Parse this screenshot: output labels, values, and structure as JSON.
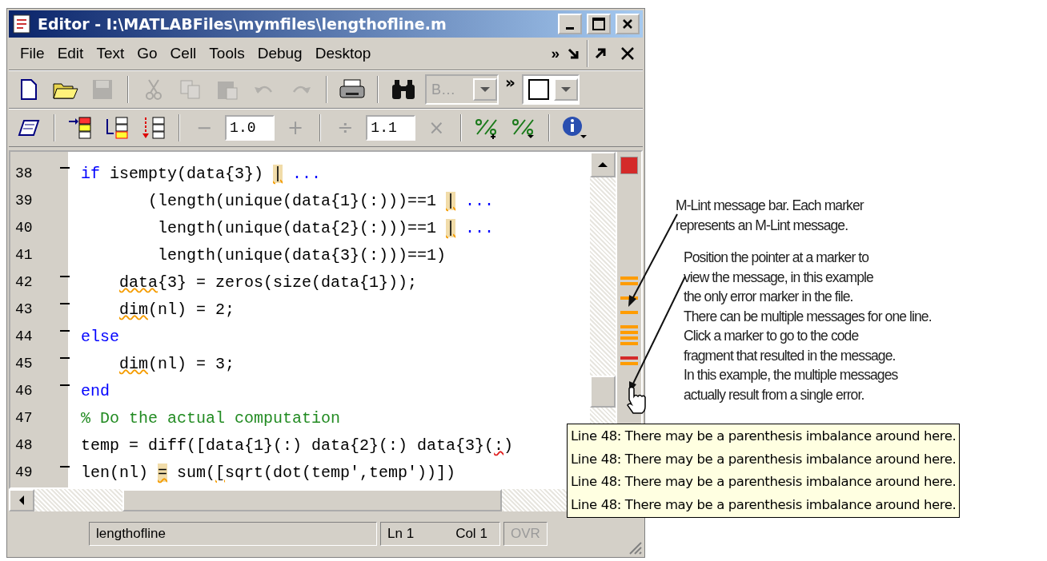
{
  "window": {
    "title": "Editor - I:\\MATLABFiles\\mymfiles\\lengthofline.m"
  },
  "menu": {
    "items": [
      "File",
      "Edit",
      "Text",
      "Go",
      "Cell",
      "Tools",
      "Debug",
      "Desktop"
    ],
    "overflow": "»"
  },
  "toolbar": {
    "items": [
      {
        "kind": "button",
        "disabled": false
      },
      {
        "kind": "button",
        "disabled": false
      },
      {
        "kind": "button",
        "disabled": true
      },
      {
        "kind": "separator"
      },
      {
        "kind": "button",
        "disabled": true
      },
      {
        "kind": "button",
        "disabled": true
      },
      {
        "kind": "button",
        "disabled": true
      },
      {
        "kind": "button",
        "disabled": true
      },
      {
        "kind": "button",
        "disabled": true
      },
      {
        "kind": "separator"
      },
      {
        "kind": "button",
        "disabled": false
      },
      {
        "kind": "separator"
      },
      {
        "kind": "button",
        "disabled": false
      },
      {
        "kind": "combo",
        "value": "B…",
        "disabled": true
      },
      {
        "kind": "overflow",
        "text": "»"
      },
      {
        "kind": "swatch-combo",
        "disabled": false
      }
    ]
  },
  "cell_toolbar": {
    "items": [
      {
        "kind": "button",
        "disabled": false
      },
      {
        "kind": "separator"
      },
      {
        "kind": "button",
        "disabled": false
      },
      {
        "kind": "button",
        "disabled": false
      },
      {
        "kind": "button",
        "disabled": false
      },
      {
        "kind": "separator"
      },
      {
        "kind": "symbol",
        "text": "−",
        "disabled": true
      },
      {
        "kind": "field",
        "value": "1.0"
      },
      {
        "kind": "symbol",
        "text": "+",
        "disabled": true
      },
      {
        "kind": "separator"
      },
      {
        "kind": "symbol",
        "text": "÷",
        "disabled": true
      },
      {
        "kind": "field",
        "value": "1.1"
      },
      {
        "kind": "symbol",
        "text": "×",
        "disabled": true
      },
      {
        "kind": "separator"
      },
      {
        "kind": "button",
        "disabled": false
      },
      {
        "kind": "button",
        "disabled": false
      },
      {
        "kind": "separator"
      },
      {
        "kind": "button",
        "disabled": false
      }
    ]
  },
  "code": {
    "lines": [
      {
        "number": "38",
        "executable": true,
        "segments": [
          {
            "kind": "keyword",
            "text": "if"
          },
          {
            "kind": "code",
            "text": " isempty(data{3}) "
          },
          {
            "kind": "warning-highlight",
            "text": "|"
          },
          {
            "kind": "keyword",
            "text": " ..."
          }
        ]
      },
      {
        "number": "39",
        "executable": false,
        "segments": [
          {
            "kind": "code",
            "text": "       (length(unique(data{1}(:)))==1 "
          },
          {
            "kind": "warning-highlight",
            "text": "|"
          },
          {
            "kind": "keyword",
            "text": " ..."
          }
        ]
      },
      {
        "number": "40",
        "executable": false,
        "segments": [
          {
            "kind": "code",
            "text": "        length(unique(data{2}(:)))==1 "
          },
          {
            "kind": "warning-highlight",
            "text": "|"
          },
          {
            "kind": "keyword",
            "text": " ..."
          }
        ]
      },
      {
        "number": "41",
        "executable": false,
        "segments": [
          {
            "kind": "code",
            "text": "        length(unique(data{3}(:)))==1)"
          }
        ]
      },
      {
        "number": "42",
        "executable": true,
        "indented": true,
        "segments": [
          {
            "kind": "warning-underline",
            "text": "data"
          },
          {
            "kind": "code",
            "text": "{3} = zeros(size(data{1}));"
          }
        ]
      },
      {
        "number": "43",
        "executable": true,
        "indented": true,
        "segments": [
          {
            "kind": "warning-underline",
            "text": "dim"
          },
          {
            "kind": "code",
            "text": "(nl) = 2;"
          }
        ]
      },
      {
        "number": "44",
        "executable": true,
        "segments": [
          {
            "kind": "keyword",
            "text": "else"
          }
        ]
      },
      {
        "number": "45",
        "executable": true,
        "indented": true,
        "segments": [
          {
            "kind": "warning-underline",
            "text": "dim"
          },
          {
            "kind": "code",
            "text": "(nl) = 3;"
          }
        ]
      },
      {
        "number": "46",
        "executable": true,
        "segments": [
          {
            "kind": "keyword",
            "text": "end"
          }
        ]
      },
      {
        "number": "47",
        "executable": false,
        "segments": [
          {
            "kind": "comment",
            "text": "% Do the actual computation"
          }
        ]
      },
      {
        "number": "48",
        "executable": false,
        "segments": [
          {
            "kind": "code",
            "text": "temp = diff([data{1}(:) data{2}(:) data{3}("
          },
          {
            "kind": "error-underline",
            "text": ":"
          },
          {
            "kind": "code",
            "text": ")"
          }
        ]
      },
      {
        "number": "49",
        "executable": true,
        "segments": [
          {
            "kind": "code",
            "text": "len(nl) "
          },
          {
            "kind": "warning-highlight",
            "text": "="
          },
          {
            "kind": "code",
            "text": " sum("
          },
          {
            "kind": "warning-underline",
            "text": "["
          },
          {
            "kind": "code",
            "text": "sqrt(dot(temp',temp'))])"
          }
        ]
      }
    ]
  },
  "marker_bar": {
    "has_errors": true,
    "groups": [
      {
        "markers": [
          {
            "kind": "warning"
          },
          {
            "kind": "warning"
          }
        ]
      },
      {
        "markers": [
          {
            "kind": "warning"
          }
        ]
      },
      {
        "markers": [
          {
            "kind": "warning"
          }
        ]
      },
      {
        "markers": [
          {
            "kind": "warning"
          },
          {
            "kind": "warning"
          },
          {
            "kind": "warning"
          },
          {
            "kind": "warning"
          }
        ]
      },
      {
        "markers": [
          {
            "kind": "error"
          },
          {
            "kind": "warning"
          }
        ]
      }
    ]
  },
  "tooltip": {
    "lines": [
      "Line 48: There may be a parenthesis imbalance around here.",
      "Line 48: There may be a parenthesis imbalance around here.",
      "Line 48: There may be a parenthesis imbalance around here.",
      "Line 48: There may be a parenthesis imbalance around here."
    ]
  },
  "status_bar": {
    "file": "lengthofline",
    "line_label": "Ln",
    "line": "1",
    "col_label": "Col",
    "col": "1",
    "mode": {
      "text": "OVR",
      "on": false
    }
  },
  "callouts": [
    {
      "lines": [
        "M-Lint message bar. Each marker",
        "represents an M-Lint message."
      ]
    },
    {
      "lines": [
        "Position the pointer at a marker to",
        "view the message, in this example",
        "the only error marker in the file.",
        "There can be multiple messages for one line.",
        "Click a marker to go to the code",
        "fragment that resulted in the message.",
        "In this example, the multiple messages",
        "actually result from a single error."
      ]
    }
  ]
}
